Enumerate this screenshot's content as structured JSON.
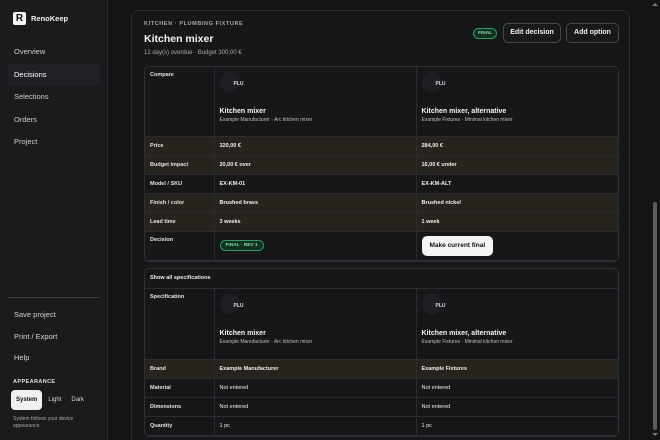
{
  "brand": {
    "logo_letter": "R",
    "name": "RenoKeep"
  },
  "nav": [
    {
      "label": "Overview",
      "active": false
    },
    {
      "label": "Decisions",
      "active": true
    },
    {
      "label": "Selections",
      "active": false
    },
    {
      "label": "Orders",
      "active": false
    },
    {
      "label": "Project",
      "active": false
    }
  ],
  "side_actions": [
    "Save project",
    "Print / Export",
    "Help"
  ],
  "appearance": {
    "label": "APPEARANCE",
    "options": [
      "System",
      "Light",
      "Dark"
    ],
    "selected": "System",
    "note": "System follows your device appearance."
  },
  "decision": {
    "eyebrow": "KITCHEN · PLUMBING FIXTURE",
    "title": "Kitchen mixer",
    "subtitle": "12 day(s) overdue · Budget 300,00 €",
    "status_badge": "FINAL",
    "edit_label": "Edit decision",
    "add_label": "Add option"
  },
  "compare": {
    "header_label": "Compare",
    "options": [
      {
        "code": "PLU",
        "name": "Kitchen mixer",
        "sub": "Example Manufacturer · Arc kitchen mixer"
      },
      {
        "code": "PLU",
        "name": "Kitchen mixer, alternative",
        "sub": "Example Fixtures · Minimal kitchen mixer"
      }
    ],
    "rows": [
      {
        "label": "Price",
        "values": [
          "320,00 €",
          "284,00 €"
        ],
        "highlight": true
      },
      {
        "label": "Budget impact",
        "values": [
          "20,00 € over",
          "16,00 € under"
        ],
        "highlight": true
      },
      {
        "label": "Model / SKU",
        "values": [
          "EX-KM-01",
          "EX-KM-ALT"
        ],
        "highlight": false
      },
      {
        "label": "Finish / color",
        "values": [
          "Brushed brass",
          "Brushed nickel"
        ],
        "highlight": true
      },
      {
        "label": "Lead time",
        "values": [
          "3 weeks",
          "1 week"
        ],
        "highlight": true
      }
    ],
    "decision_label": "Decision",
    "final_pill": "FINAL · REV 1",
    "make_final_label": "Make current final"
  },
  "specs": {
    "toggle_label": "Show all specifications",
    "header_label": "Specification",
    "options": [
      {
        "code": "PLU",
        "name": "Kitchen mixer",
        "sub": "Example Manufacturer · Arc kitchen mixer"
      },
      {
        "code": "PLU",
        "name": "Kitchen mixer, alternative",
        "sub": "Example Fixtures · Minimal kitchen mixer"
      }
    ],
    "rows": [
      {
        "label": "Brand",
        "values": [
          "Example Manufacturer",
          "Example Fixtures"
        ],
        "highlight": true
      },
      {
        "label": "Material",
        "values": [
          "Not entered",
          "Not entered"
        ],
        "highlight": false
      },
      {
        "label": "Dimensions",
        "values": [
          "Not entered",
          "Not entered"
        ],
        "highlight": false
      },
      {
        "label": "Quantity",
        "values": [
          "1 pc",
          "1 pc"
        ],
        "highlight": false
      }
    ]
  },
  "colors": {
    "accent_green": "#2f9d64",
    "highlight_row": "#26241c"
  }
}
